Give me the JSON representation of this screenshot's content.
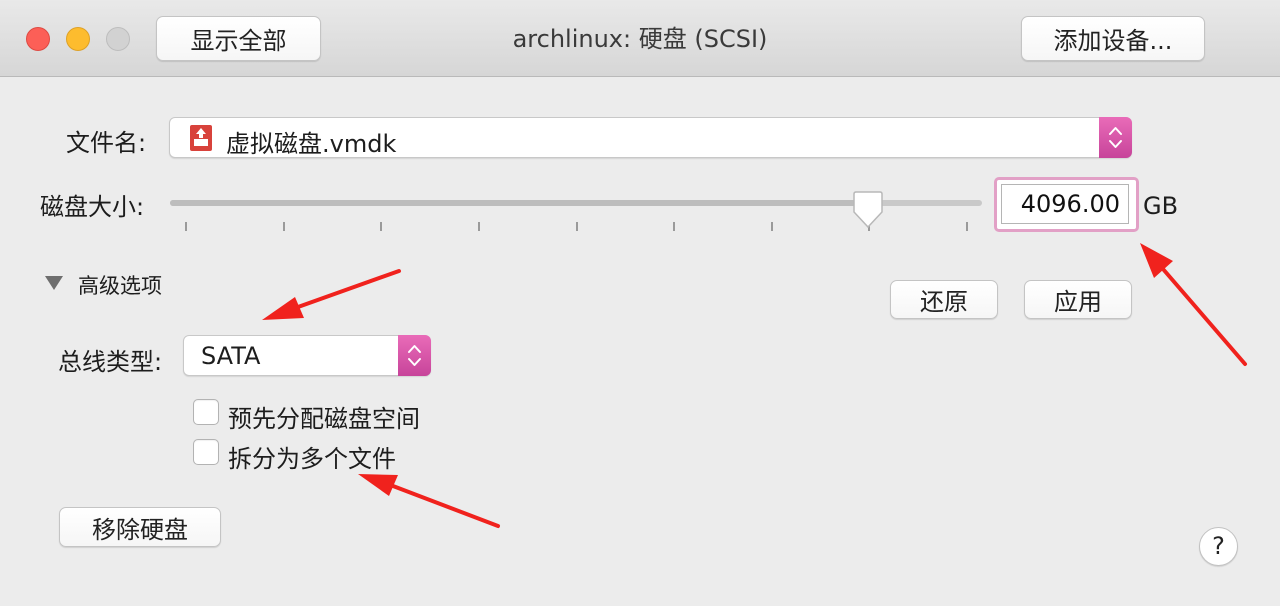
{
  "window": {
    "title": "archlinux: 硬盘 (SCSI)",
    "show_all_label": "显示全部",
    "add_device_label": "添加设备..."
  },
  "file": {
    "label": "文件名:",
    "value": "虚拟磁盘.vmdk",
    "icon": "disk-file-icon"
  },
  "disk_size": {
    "label": "磁盘大小:",
    "value": "4096.00",
    "unit": "GB",
    "slider_fraction": 0.86
  },
  "advanced": {
    "label": "高级选项",
    "revert_label": "还原",
    "apply_label": "应用",
    "bus_type_label": "总线类型:",
    "bus_type_value": "SATA",
    "preallocate_label": "预先分配磁盘空间",
    "preallocate_checked": false,
    "split_label": "拆分为多个文件",
    "split_checked": false
  },
  "remove_label": "移除硬盘",
  "help_label": "?",
  "colors": {
    "accent": "#d455a8",
    "close": "#fc5f57",
    "minimize": "#fdbc2e",
    "annotation_arrow": "#f0221d"
  }
}
